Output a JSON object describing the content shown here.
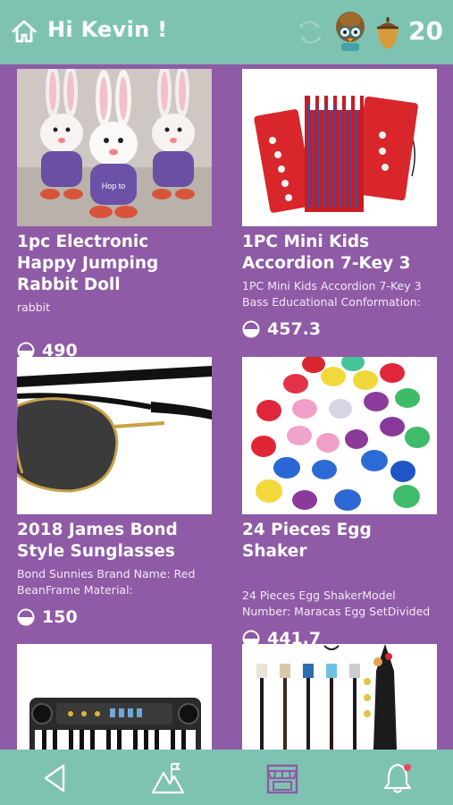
{
  "header": {
    "greeting": "Hi Kevin !",
    "coins": "20",
    "icons": [
      "home-icon",
      "sync-icon",
      "avatar",
      "acorn-icon"
    ]
  },
  "products": [
    {
      "title": "1pc Electronic Happy Jumping Rabbit Doll",
      "desc": "rabbit",
      "price": "490",
      "image": "rabbit-dolls"
    },
    {
      "title": "1PC Mini Kids Accordion 7-Key 3",
      "desc": "1PC Mini Kids Accordion 7-Key 3 Bass Educational Conformation:",
      "price": "457.3",
      "image": "accordion"
    },
    {
      "title": "2018 James Bond Style Sunglasses",
      "desc": "Bond Sunnies Brand Name: Red BeanFrame Material:",
      "price": "150",
      "image": "sunglasses"
    },
    {
      "title": "24 Pieces Egg Shaker",
      "desc": "24 Pieces Egg ShakerModel Number: Maracas Egg SetDivided",
      "price": "441.7",
      "image": "egg-shakers"
    },
    {
      "title": "",
      "desc": "",
      "price": "",
      "image": "keyboard"
    },
    {
      "title": "",
      "desc": "",
      "price": "",
      "image": "guitars"
    }
  ],
  "nav": [
    "back-icon",
    "mountain-icon",
    "store-icon",
    "bell-icon"
  ],
  "colors": {
    "header": "#7ec3b1",
    "background": "#8f5aa6",
    "notification": "#e84a5f"
  }
}
